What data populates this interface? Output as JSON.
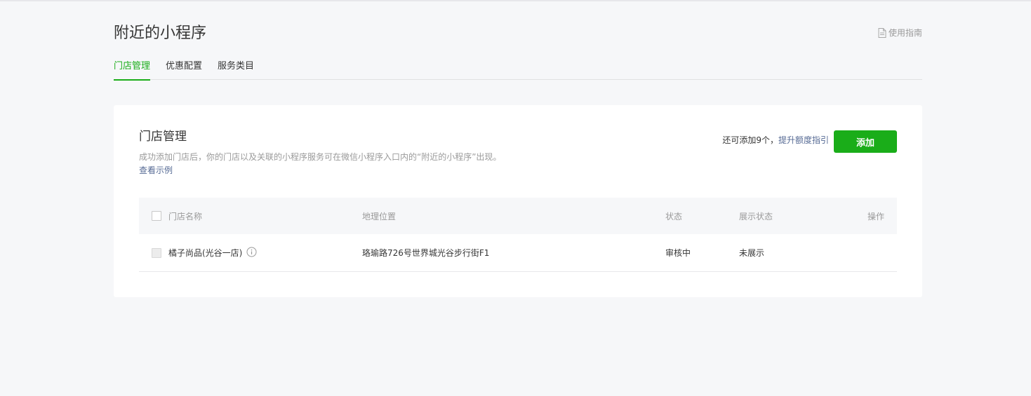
{
  "page": {
    "title": "附近的小程序",
    "guide_label": "使用指南"
  },
  "tabs": [
    {
      "label": "门店管理",
      "active": true
    },
    {
      "label": "优惠配置",
      "active": false
    },
    {
      "label": "服务类目",
      "active": false
    }
  ],
  "card": {
    "title": "门店管理",
    "description": "成功添加门店后，你的门店以及关联的小程序服务可在微信小程序入口内的“附近的小程序”出现。",
    "example_link": "查看示例",
    "quota_text": "还可添加9个，",
    "quota_link": "提升额度指引",
    "add_button": "添加"
  },
  "table": {
    "columns": {
      "name": "门店名称",
      "location": "地理位置",
      "status": "状态",
      "display_status": "展示状态",
      "actions": "操作"
    },
    "rows": [
      {
        "name": "橘子尚品(光谷一店)",
        "location": "珞瑜路726号世界城光谷步行街F1",
        "status": "审核中",
        "display_status": "未展示"
      }
    ]
  },
  "colors": {
    "accent": "#1aad19",
    "link": "#576b95",
    "muted": "#9a9a9a",
    "text": "#353535",
    "background": "#f6f7f9"
  },
  "icons": {
    "guide": "document-icon",
    "row_info": "info-icon"
  }
}
